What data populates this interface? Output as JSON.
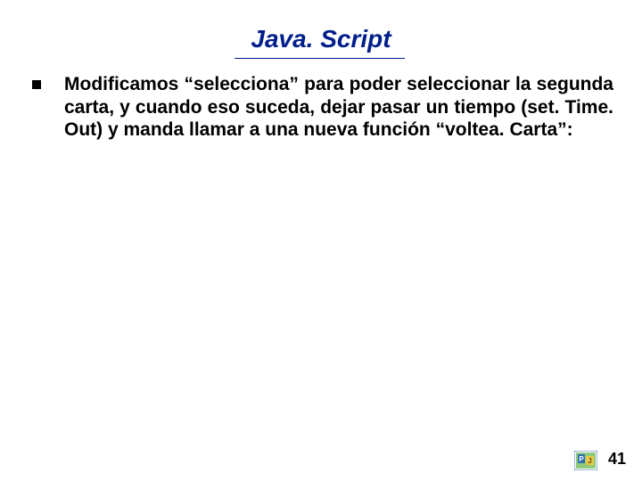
{
  "title": "Java. Script",
  "body": {
    "bullets": [
      "Modificamos “selecciona” para poder seleccionar la segunda carta, y cuando eso suceda, dejar pasar un tiempo (set. Time. Out) y manda llamar a una nueva función “voltea. Carta”:"
    ]
  },
  "page_number": "41",
  "logo_name": "pj-logo"
}
